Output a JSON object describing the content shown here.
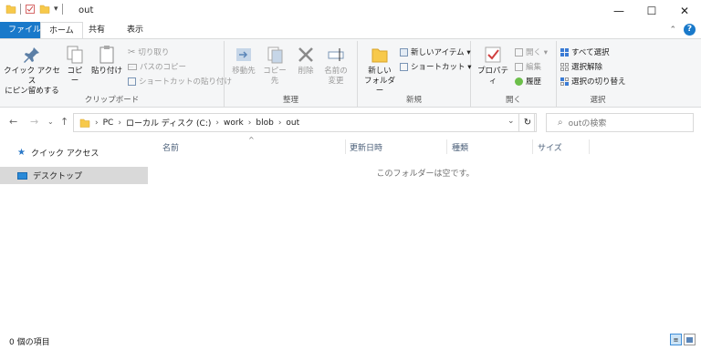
{
  "window": {
    "title": "out",
    "minimize": "—",
    "maximize": "☐",
    "close": "✕"
  },
  "tabs": {
    "file": "ファイル",
    "home": "ホーム",
    "share": "共有",
    "view": "表示"
  },
  "ribbon": {
    "clipboard": {
      "label": "クリップボード",
      "pin_quick_access": [
        "クイック アクセス",
        "にピン留めする"
      ],
      "copy": "コピー",
      "paste": "貼り付け",
      "cut": "切り取り",
      "copy_path": "パスのコピー",
      "paste_shortcut": "ショートカットの貼り付け"
    },
    "organize": {
      "label": "整理",
      "move_to": "移動先",
      "copy_to": "コピー先",
      "delete": "削除",
      "rename": [
        "名前の",
        "変更"
      ]
    },
    "new": {
      "label": "新規",
      "new_folder": [
        "新しい",
        "フォルダー"
      ],
      "new_item": "新しいアイテム ▾",
      "easy_access": "ショートカット ▾"
    },
    "open": {
      "label": "開く",
      "properties": "プロパティ",
      "open": "開く ▾",
      "edit": "編集",
      "history": "履歴"
    },
    "select": {
      "label": "選択",
      "select_all": "すべて選択",
      "select_none": "選択解除",
      "invert": "選択の切り替え"
    }
  },
  "address": {
    "path": [
      "PC",
      "ローカル ディスク (C:)",
      "work",
      "blob",
      "out"
    ],
    "search_placeholder": "outの検索"
  },
  "navpane": {
    "items": [
      {
        "label": "クイック アクセス"
      },
      {
        "label": "デスクトップ"
      }
    ]
  },
  "columns": [
    "名前",
    "更新日時",
    "種類",
    "サイズ"
  ],
  "empty_message": "このフォルダーは空です。",
  "status": {
    "item_count": "0 個の項目"
  },
  "colors": {
    "accent": "#1979ca",
    "selected": "#d9d9d9",
    "folder": "#f7c94b"
  }
}
